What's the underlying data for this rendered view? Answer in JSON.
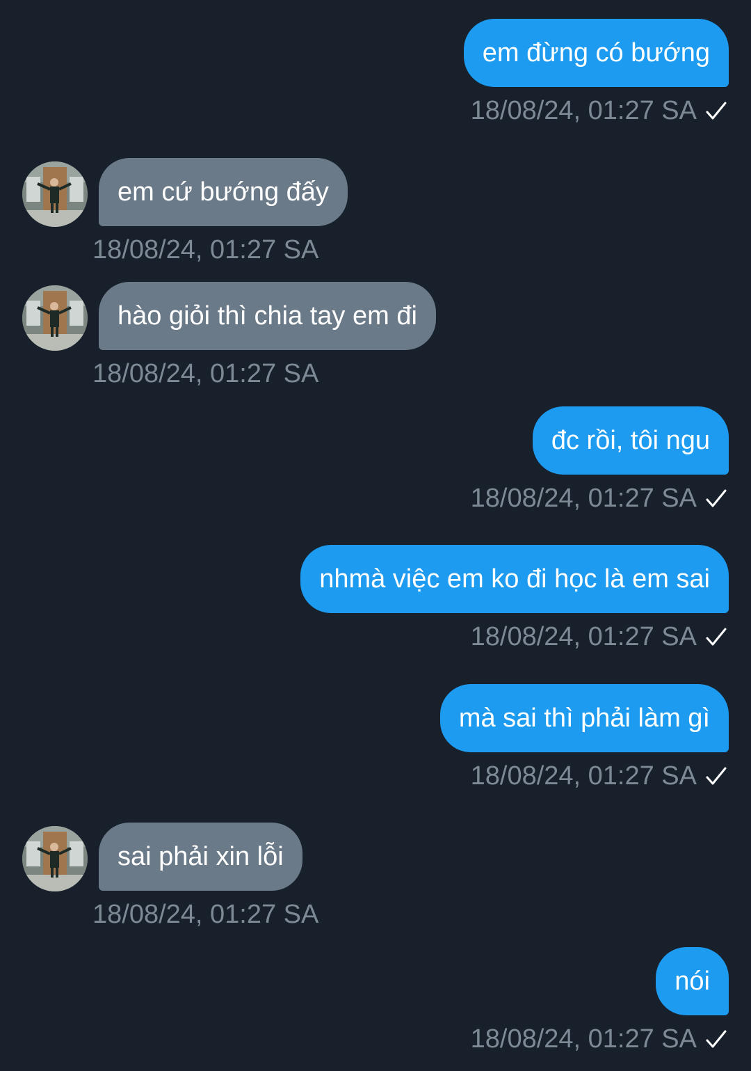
{
  "messages": [
    {
      "direction": "out",
      "text": "em đừng có bướng",
      "time": "18/08/24, 01:27 SA",
      "status": "sent"
    },
    {
      "direction": "in",
      "text": "em cứ bướng đấy",
      "time": "18/08/24, 01:27 SA"
    },
    {
      "direction": "in",
      "text": "hào giỏi thì chia tay em đi",
      "time": "18/08/24, 01:27 SA"
    },
    {
      "direction": "out",
      "text": "đc rồi, tôi ngu",
      "time": "18/08/24, 01:27 SA",
      "status": "sent"
    },
    {
      "direction": "out",
      "text": "nhmà việc em ko đi học là em sai",
      "time": "18/08/24, 01:27 SA",
      "status": "sent"
    },
    {
      "direction": "out",
      "text": "mà sai thì phải làm gì",
      "time": "18/08/24, 01:27 SA",
      "status": "sent"
    },
    {
      "direction": "in",
      "text": "sai phải xin lỗi",
      "time": "18/08/24, 01:27 SA"
    },
    {
      "direction": "out",
      "text": "nói",
      "time": "18/08/24, 01:27 SA",
      "status": "sent"
    }
  ],
  "colors": {
    "background": "#17202b",
    "outgoing_bubble": "#1d9bf0",
    "incoming_bubble": "#6b7a88",
    "timestamp": "#7d8a96"
  },
  "icons": {
    "status": "check-icon",
    "avatar": "contact-avatar-photo"
  }
}
